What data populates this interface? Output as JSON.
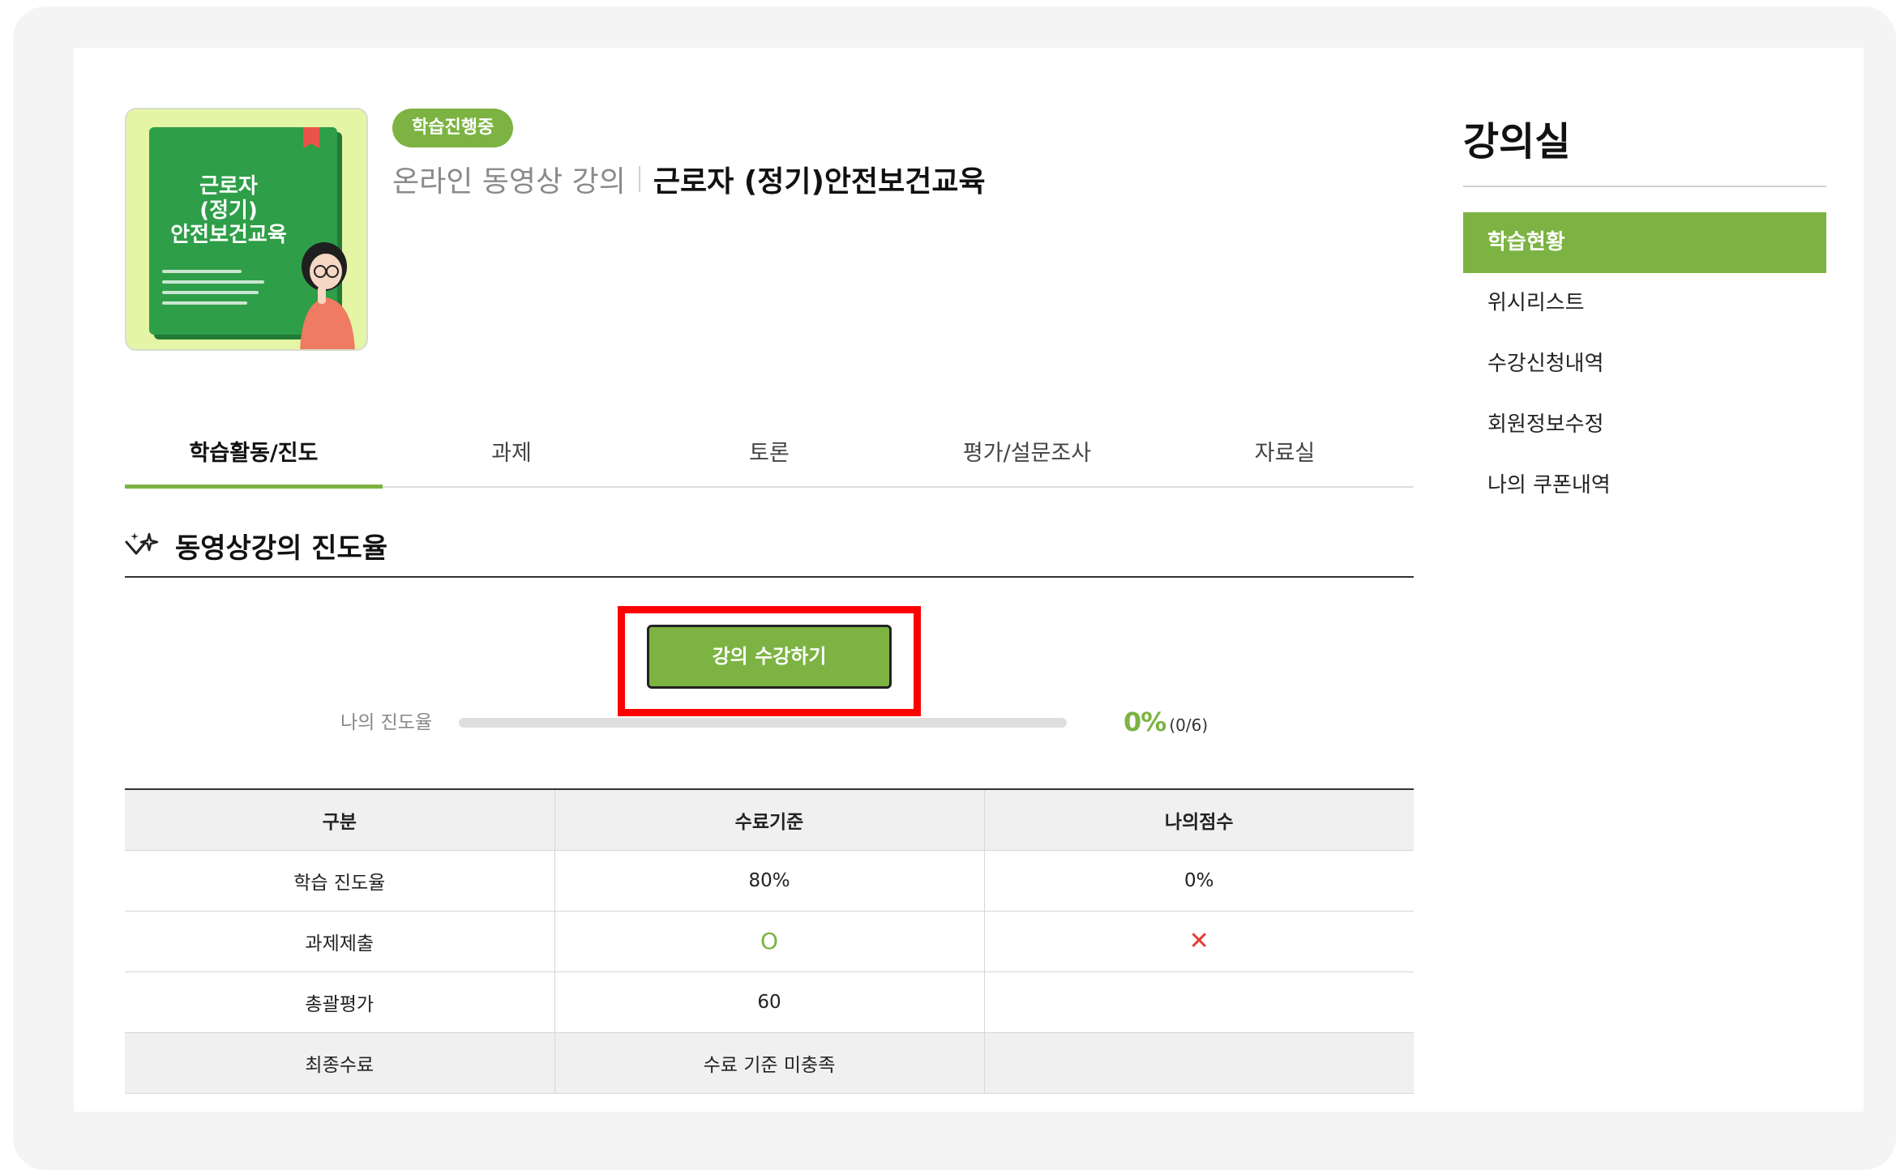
{
  "course": {
    "status_badge": "학습진행중",
    "type": "온라인 동영상 강의",
    "name": "근로자 (정기)안전보건교육",
    "thumbnail_title": "근로자\n(정기)\n안전보건교육"
  },
  "tabs": [
    {
      "label": "학습활동/진도",
      "active": true
    },
    {
      "label": "과제",
      "active": false
    },
    {
      "label": "토론",
      "active": false
    },
    {
      "label": "평가/설문조사",
      "active": false
    },
    {
      "label": "자료실",
      "active": false
    }
  ],
  "section": {
    "title": "동영상강의 진도율",
    "watch_button": "강의 수강하기"
  },
  "progress": {
    "label": "나의 진도율",
    "percent_text": "0%",
    "count_text": "(0/6)",
    "fraction": 0
  },
  "table": {
    "headers": [
      "구분",
      "수료기준",
      "나의점수"
    ],
    "rows": [
      [
        "학습 진도율",
        "80%",
        "0%"
      ],
      [
        "과제제출",
        "O",
        "✕"
      ],
      [
        "총괄평가",
        "60",
        ""
      ],
      [
        "최종수료",
        "수료 기준 미충족",
        ""
      ]
    ]
  },
  "sidebar": {
    "title": "강의실",
    "items": [
      {
        "label": "학습현황",
        "active": true
      },
      {
        "label": "위시리스트",
        "active": false
      },
      {
        "label": "수강신청내역",
        "active": false
      },
      {
        "label": "회원정보수정",
        "active": false
      },
      {
        "label": "나의 쿠폰내역",
        "active": false
      }
    ]
  },
  "colors": {
    "accent": "#7cb342",
    "highlight": "#ff0000",
    "fail": "#e53935"
  }
}
